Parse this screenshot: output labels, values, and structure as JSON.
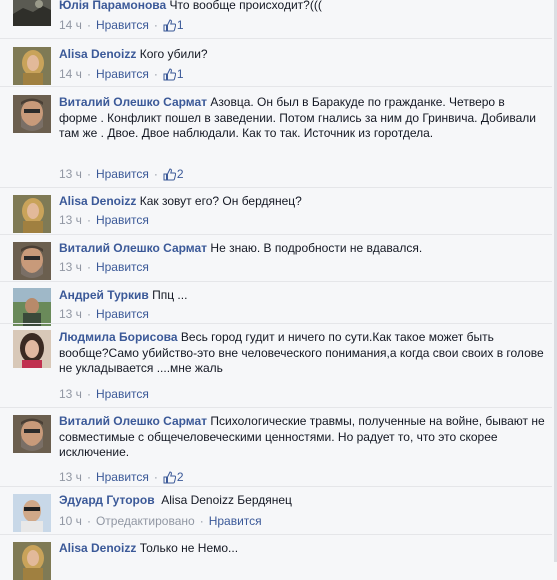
{
  "comments": [
    {
      "author": "Юлія Парамонова",
      "text": "Что вообще происходит?(((",
      "time": "14 ч",
      "like_label": "Нравится",
      "likes": "1",
      "avatar": "dark-landscape"
    },
    {
      "author": "Alisa Denoizz",
      "text": "Кого убили?",
      "time": "14 ч",
      "like_label": "Нравится",
      "likes": "1",
      "avatar": "blonde-woman"
    },
    {
      "author": "Виталий Олешко Сармат",
      "text": "Азовца. Он был в Баракуде по гражданке. Четверо в форме . Конфликт пошел в заведении. Потом гнались за ним до Гринвича. Добивали там же . Двое. Двое наблюдали. Как то так. Источник из горотдела.",
      "time": "13 ч",
      "like_label": "Нравится",
      "likes": "2",
      "avatar": "bearded-man"
    },
    {
      "author": "Alisa Denoizz",
      "text": "Как зовут его? Он бердянец?",
      "time": "13 ч",
      "like_label": "Нравится",
      "likes": "",
      "avatar": "blonde-woman"
    },
    {
      "author": "Виталий Олешко Сармат",
      "text": "Не знаю. В подробности не вдавался.",
      "time": "13 ч",
      "like_label": "Нравится",
      "likes": "",
      "avatar": "bearded-man"
    },
    {
      "author": "Андрей Туркив",
      "text": "Ппц ...",
      "time": "13 ч",
      "like_label": "Нравится",
      "likes": "",
      "avatar": "outdoor-man"
    },
    {
      "author": "Людмила Борисова",
      "text": "Весь город гудит и ничего по сути.Как такое может быть вообще?Само убийство-это вне человеческого понимания,а когда свои своих в голове не укладывается ....мне жаль",
      "time": "13 ч",
      "like_label": "Нравится",
      "likes": "",
      "avatar": "dark-hair-woman"
    },
    {
      "author": "Виталий Олешко Сармат",
      "text": "Психологические травмы, полученные на войне, бывают не совместимые с общечеловеческими ценностями. Но радует то, что это скорее исключение.",
      "time": "13 ч",
      "like_label": "Нравится",
      "likes": "2",
      "avatar": "bearded-man"
    },
    {
      "author": "Эдуард Гуторов",
      "text": "Alisa Denoizz Бердянец",
      "time": "10 ч",
      "edited_label": "Отредактировано",
      "like_label": "Нравится",
      "likes": "",
      "avatar": "man-sunglasses"
    },
    {
      "author": "Alisa Denoizz",
      "text": "Только не Немо...",
      "time": "",
      "like_label": "",
      "likes": "",
      "avatar": "blonde-woman"
    }
  ],
  "colors": {
    "author": "#3b5998",
    "meta": "#9197a3",
    "background": "#f6f7f9"
  },
  "icons": {
    "like": "thumbs-up-icon"
  }
}
